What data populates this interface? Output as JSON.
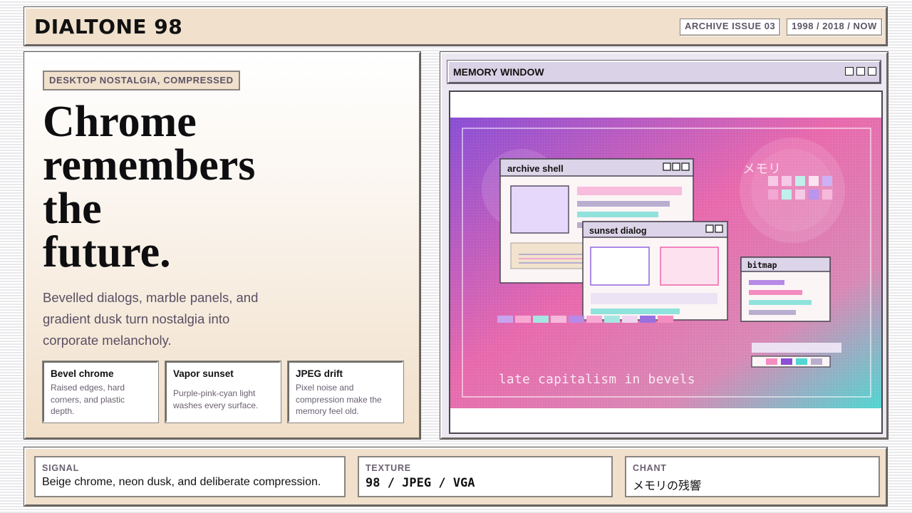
{
  "header": {
    "brand": "DIALTONE 98",
    "tags": [
      "ARCHIVE ISSUE 03",
      "1998 / 2018 / NOW"
    ]
  },
  "hero": {
    "kicker": "DESKTOP NOSTALGIA, COMPRESSED",
    "headline_lines": [
      "Chrome",
      "remembers",
      "the",
      "future."
    ],
    "lede": "Bevelled dialogs, marble panels, and gradient dusk turn nostalgia into corporate melancholy.",
    "features": [
      {
        "title": "Bevel chrome",
        "body": "Raised edges, hard corners, and plastic depth."
      },
      {
        "title": "Vapor sunset",
        "body": "Purple-pink-cyan light washes every surface."
      },
      {
        "title": "JPEG drift",
        "body": "Pixel noise and compression make the memory feel old."
      }
    ]
  },
  "window": {
    "title": "MEMORY WINDOW",
    "scene": {
      "windows": [
        "archive shell",
        "sunset dialog",
        "bitmap"
      ],
      "overlay_jp": "メモリ",
      "caption": "late capitalism in bevels"
    }
  },
  "footer": [
    {
      "label": "SIGNAL",
      "value": "Beige chrome, neon dusk, and deliberate compression."
    },
    {
      "label": "TEXTURE",
      "value": "98 / JPEG / VGA"
    },
    {
      "label": "CHANT",
      "value": "メモリの残響"
    }
  ],
  "colors": {
    "beige": "#f0e0cc",
    "lavender": "#dad2e6",
    "purple": "#8a4fd6",
    "pink": "#e96aae",
    "cyan": "#52d6d2"
  }
}
